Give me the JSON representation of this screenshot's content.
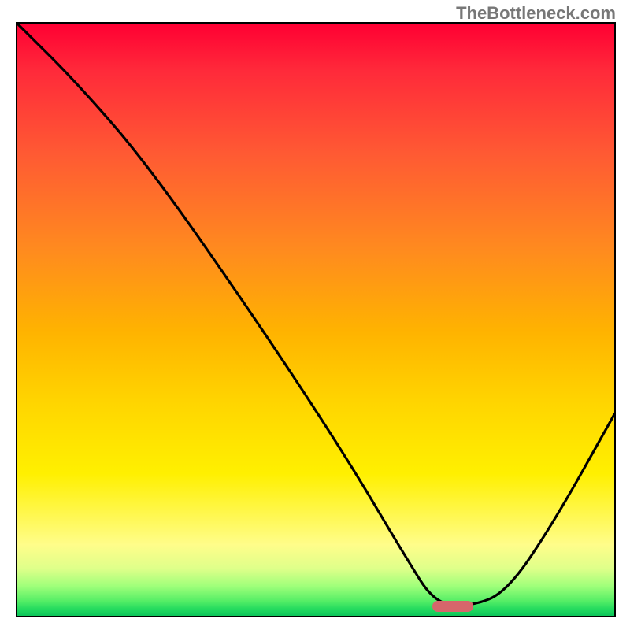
{
  "watermark": "TheBottleneck.com",
  "marker": {
    "x_pct": 73,
    "y_pct": 98.4
  },
  "chart_data": {
    "type": "line",
    "title": "",
    "xlabel": "",
    "ylabel": "",
    "xlim": [
      0,
      100
    ],
    "ylim": [
      0,
      100
    ],
    "grid": false,
    "legend": false,
    "series": [
      {
        "name": "bottleneck-curve",
        "x": [
          0,
          10,
          22,
          40,
          55,
          65,
          70,
          76,
          82,
          90,
          100
        ],
        "y": [
          100,
          90,
          76,
          50,
          27,
          10,
          2,
          1.6,
          4,
          16,
          34
        ]
      }
    ],
    "annotations": [
      {
        "name": "optimal-marker",
        "x": 73,
        "y": 1.6
      }
    ],
    "background": "red-yellow-green-vertical-gradient"
  }
}
